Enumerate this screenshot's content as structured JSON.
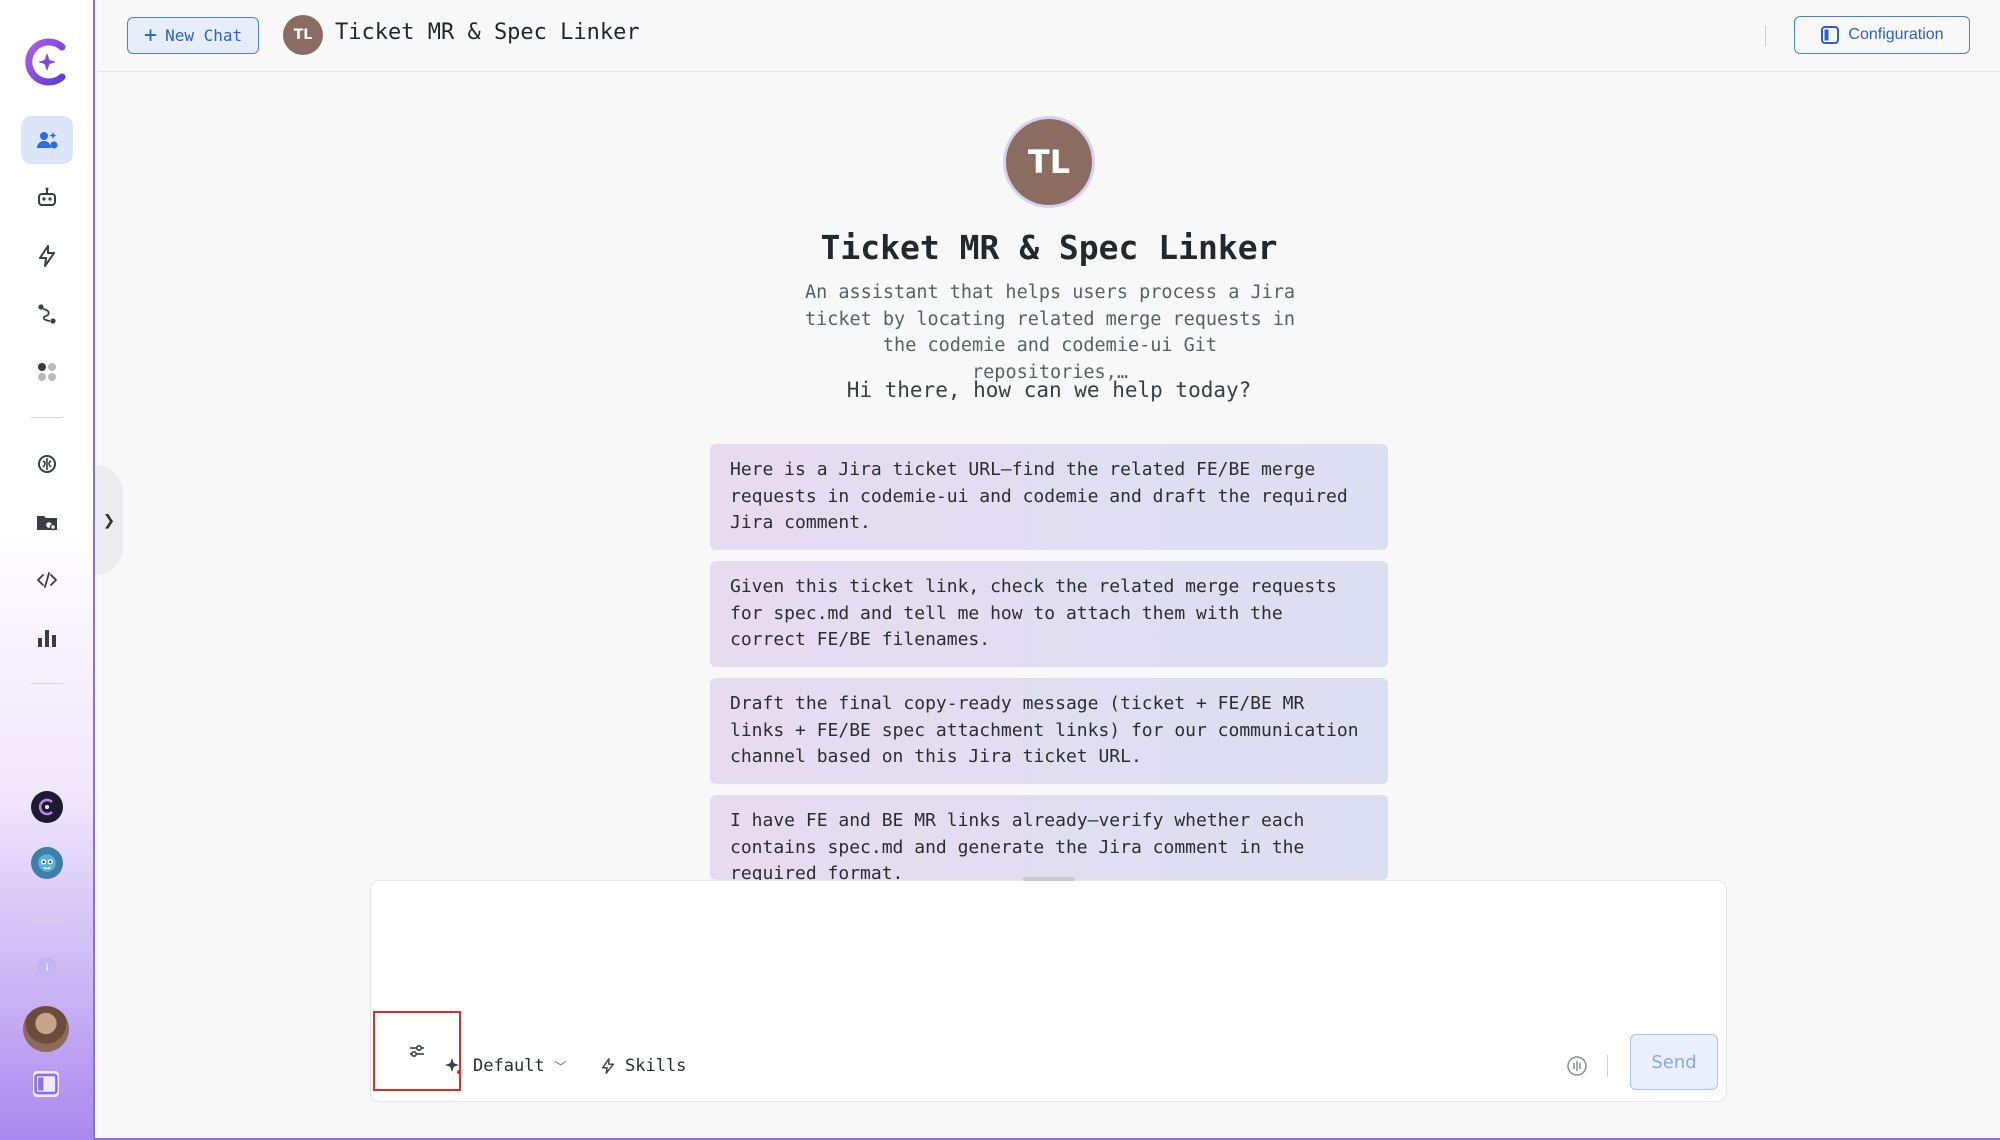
{
  "header": {
    "new_chat_label": "New Chat",
    "assistant_initials": "TL",
    "assistant_name": "Ticket MR & Spec Linker",
    "configuration_label": "Configuration"
  },
  "main": {
    "avatar_initials": "TL",
    "title": "Ticket MR & Spec Linker",
    "description": "An assistant that helps users process a Jira ticket by locating related merge requests in the codemie and codemie-ui Git repositories,…",
    "greeting": "Hi there, how can we help today?",
    "suggestions": [
      "Here is a Jira ticket URL—find the related FE/BE merge requests in codemie-ui and codemie and draft the required Jira comment.",
      "Given this ticket link, check the related merge requests for spec.md and tell me how to attach them with the correct FE/BE filenames.",
      "Draft the final copy-ready message (ticket + FE/BE MR links + FE/BE spec attachment links) for our communication channel based on this Jira ticket URL.",
      "I have FE and BE MR links already—verify whether each contains spec.md and generate the Jira comment in the required format."
    ]
  },
  "composer": {
    "input_value": "",
    "model_label": "Default",
    "skills_label": "Skills",
    "send_label": "Send"
  },
  "sidebar": {
    "items": [
      "assistants-icon",
      "robot-icon",
      "lightning-icon",
      "workflow-icon",
      "apps-icon",
      "brain-icon",
      "folder-link-icon",
      "code-icon",
      "chart-icon"
    ],
    "info_badge": "i"
  },
  "colors": {
    "accent": "#2d5fcf",
    "sidebar_gradient_end": "#a889ee",
    "avatar_bg": "#8a6c60",
    "highlight_box": "#e02b2b"
  }
}
